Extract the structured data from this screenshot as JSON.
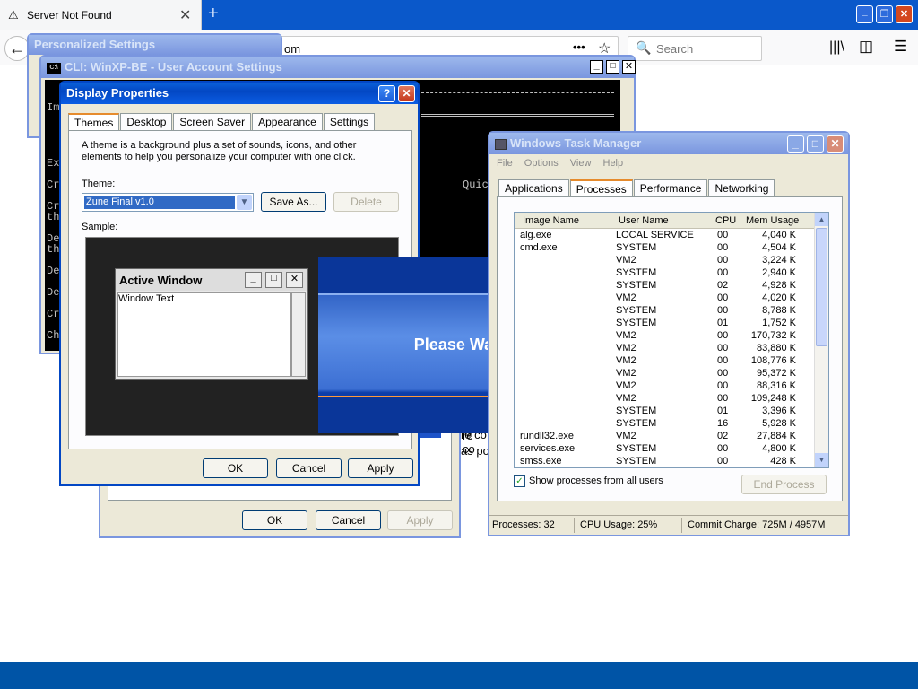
{
  "browser": {
    "tab_title": "Server Not Found",
    "url_fragment": "om",
    "search_placeholder": "Search"
  },
  "personalized": {
    "title": "Personalized Settings"
  },
  "cli": {
    "title": "CLI: WinXP-BE - User Account Settings",
    "lines": [
      "Im",
      "Ex",
      "Cr",
      "Cr",
      "th",
      "De",
      "th",
      "De",
      "De",
      "Cr",
      "Ch"
    ],
    "side_text": "Quic"
  },
  "back_dialog": {
    "ok": "OK",
    "cancel": "Cancel",
    "apply": "Apply",
    "bg_text_1": "re co",
    "bg_text_2": "as po"
  },
  "display": {
    "title": "Display Properties",
    "tabs": [
      "Themes",
      "Desktop",
      "Screen Saver",
      "Appearance",
      "Settings"
    ],
    "description": "A theme is a background plus a set of sounds, icons, and other elements to help you personalize your computer with one click.",
    "theme_label": "Theme:",
    "theme_value": "Zune Final v1.0",
    "save_as": "Save As...",
    "delete": "Delete",
    "sample_label": "Sample:",
    "active_window": "Active Window",
    "window_text": "Window Text",
    "ok": "OK",
    "cancel": "Cancel",
    "apply": "Apply"
  },
  "splash": {
    "text": "Please Wait"
  },
  "taskmgr": {
    "title": "Windows Task Manager",
    "menu": [
      "File",
      "Options",
      "View",
      "Help"
    ],
    "tabs": [
      "Applications",
      "Processes",
      "Performance",
      "Networking"
    ],
    "headers": [
      "Image Name",
      "User Name",
      "CPU",
      "Mem Usage"
    ],
    "rows": [
      [
        "alg.exe",
        "LOCAL SERVICE",
        "00",
        "4,040 K"
      ],
      [
        "cmd.exe",
        "SYSTEM",
        "00",
        "4,504 K"
      ],
      [
        "",
        "VM2",
        "00",
        "3,224 K"
      ],
      [
        "",
        "SYSTEM",
        "00",
        "2,940 K"
      ],
      [
        "",
        "SYSTEM",
        "02",
        "4,928 K"
      ],
      [
        "",
        "VM2",
        "00",
        "4,020 K"
      ],
      [
        "",
        "SYSTEM",
        "00",
        "8,788 K"
      ],
      [
        "",
        "SYSTEM",
        "01",
        "1,752 K"
      ],
      [
        "",
        "VM2",
        "00",
        "170,732 K"
      ],
      [
        "",
        "VM2",
        "00",
        "83,880 K"
      ],
      [
        "",
        "VM2",
        "00",
        "108,776 K"
      ],
      [
        "",
        "VM2",
        "00",
        "95,372 K"
      ],
      [
        "",
        "VM2",
        "00",
        "88,316 K"
      ],
      [
        "",
        "VM2",
        "00",
        "109,248 K"
      ],
      [
        "",
        "SYSTEM",
        "01",
        "3,396 K"
      ],
      [
        "",
        "SYSTEM",
        "16",
        "5,928 K"
      ],
      [
        "rundll32.exe",
        "VM2",
        "02",
        "27,884 K"
      ],
      [
        "services.exe",
        "SYSTEM",
        "00",
        "4,800 K"
      ],
      [
        "smss.exe",
        "SYSTEM",
        "00",
        "428 K"
      ]
    ],
    "show_all": "Show processes from all users",
    "end_process": "End Process",
    "status_processes": "Processes: 32",
    "status_cpu": "CPU Usage: 25%",
    "status_commit": "Commit Charge: 725M / 4957M"
  }
}
